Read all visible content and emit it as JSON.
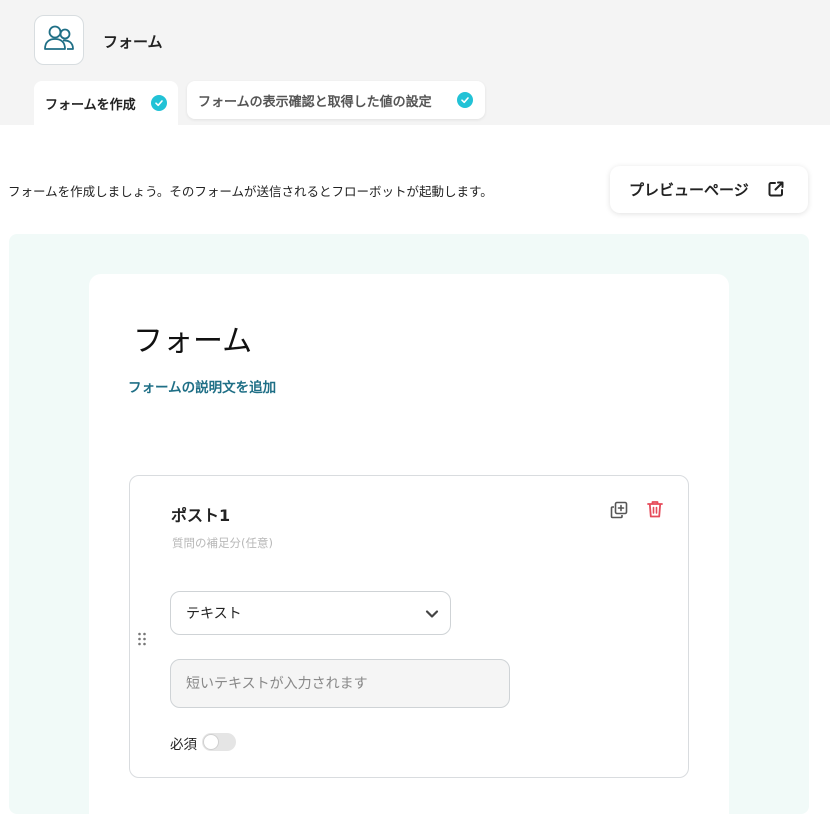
{
  "app": {
    "title": "フォーム",
    "icon": "users-icon"
  },
  "tabs": [
    {
      "label": "フォームを作成",
      "completed": true
    },
    {
      "label": "フォームの表示確認と取得した値の設定",
      "completed": true
    }
  ],
  "intro_text": "フォームを作成しましょう。そのフォームが送信されるとフローボットが起動します。",
  "preview_button": {
    "label": "プレビューページ",
    "icon": "external-link-icon"
  },
  "form": {
    "title": "フォーム",
    "add_description_link": "フォームの説明文を追加"
  },
  "question": {
    "title": "ポスト1",
    "subtitle": "質問の補足分(任意)",
    "type_select": {
      "selected": "テキスト"
    },
    "answer_placeholder": "短いテキストが入力されます",
    "required_label": "必須",
    "required": false
  },
  "colors": {
    "accent_teal": "#1f6f86",
    "check_cyan": "#22c2d6",
    "trash_red": "#e64b5a",
    "canvas_bg": "#f1faf8"
  }
}
